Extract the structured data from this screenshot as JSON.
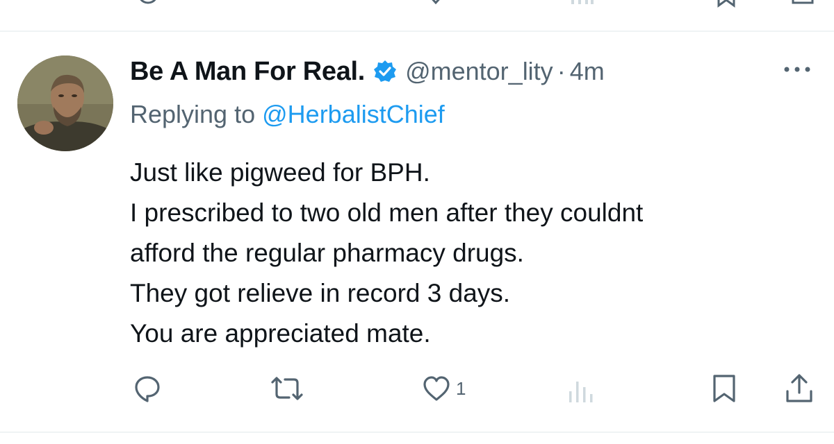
{
  "previous_tweet": {
    "icons": [
      "reply-icon",
      "retweet-icon",
      "like-icon",
      "views-icon",
      "bookmark-icon",
      "share-icon"
    ]
  },
  "tweet": {
    "author": {
      "display_name": "Be A Man For Real.",
      "handle": "@mentor_lity",
      "verified": true,
      "avatar_icon": "avatar-photo"
    },
    "separator": "·",
    "time": "4m",
    "reply_prefix": "Replying to",
    "reply_to": "@HerbalistChief",
    "body_lines": [
      "Just like pigweed for BPH.",
      "I prescribed to two old men after they couldnt",
      "afford the regular pharmacy drugs.",
      "They got relieve in record 3 days.",
      "You are appreciated mate."
    ],
    "actions": {
      "like_count": "1"
    }
  },
  "colors": {
    "text_primary": "#0f1419",
    "text_secondary": "#536471",
    "accent": "#1d9bf0",
    "divider": "#eff3f4",
    "views_icon": "#cfd9de"
  }
}
